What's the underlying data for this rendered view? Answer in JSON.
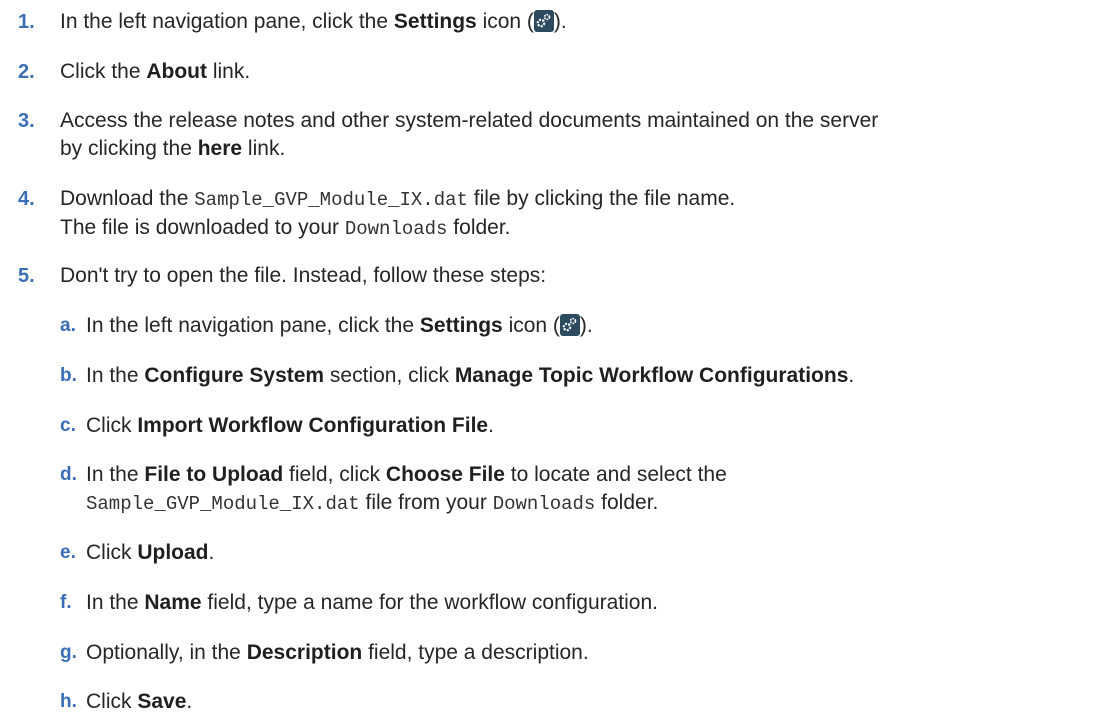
{
  "steps": [
    {
      "num": "1.",
      "parts": [
        {
          "t": "In the left navigation pane, click the "
        },
        {
          "b": "Settings"
        },
        {
          "t": " icon ("
        },
        {
          "icon": "settings-icon"
        },
        {
          "t": ")."
        }
      ]
    },
    {
      "num": "2.",
      "parts": [
        {
          "t": "Click the "
        },
        {
          "b": "About"
        },
        {
          "t": " link."
        }
      ]
    },
    {
      "num": "3.",
      "lines": [
        [
          {
            "t": "Access the release notes and other system-related documents maintained on the server"
          }
        ],
        [
          {
            "t": "by clicking the "
          },
          {
            "b": "here"
          },
          {
            "t": " link."
          }
        ]
      ]
    },
    {
      "num": "4.",
      "lines": [
        [
          {
            "t": "Download the "
          },
          {
            "m": "Sample_GVP_Module_IX.dat"
          },
          {
            "t": " file by clicking the file name."
          }
        ],
        [
          {
            "t": "The file is downloaded to your "
          },
          {
            "m": "Downloads"
          },
          {
            "t": " folder."
          }
        ]
      ]
    },
    {
      "num": "5.",
      "parts": [
        {
          "t": "Don't try to open the file. Instead, follow these steps:"
        }
      ]
    }
  ],
  "substeps": [
    {
      "num": "a.",
      "parts": [
        {
          "t": "In the left navigation pane, click the "
        },
        {
          "b": "Settings"
        },
        {
          "t": " icon ("
        },
        {
          "icon": "settings-icon"
        },
        {
          "t": ")."
        }
      ]
    },
    {
      "num": "b.",
      "parts": [
        {
          "t": "In the "
        },
        {
          "b": "Configure System"
        },
        {
          "t": " section, click "
        },
        {
          "b": "Manage Topic Workflow Configurations"
        },
        {
          "t": "."
        }
      ]
    },
    {
      "num": "c.",
      "parts": [
        {
          "t": "Click "
        },
        {
          "b": "Import Workflow Configuration File"
        },
        {
          "t": "."
        }
      ]
    },
    {
      "num": "d.",
      "lines": [
        [
          {
            "t": "In the "
          },
          {
            "b": "File to Upload"
          },
          {
            "t": " field, click "
          },
          {
            "b": "Choose File"
          },
          {
            "t": " to locate and select the"
          }
        ],
        [
          {
            "m": "Sample_GVP_Module_IX.dat"
          },
          {
            "t": " file from your "
          },
          {
            "m": "Downloads"
          },
          {
            "t": " folder."
          }
        ]
      ]
    },
    {
      "num": "e.",
      "parts": [
        {
          "t": "Click "
        },
        {
          "b": "Upload"
        },
        {
          "t": "."
        }
      ]
    },
    {
      "num": "f.",
      "parts": [
        {
          "t": "In the "
        },
        {
          "b": "Name"
        },
        {
          "t": " field, type a name for the workflow configuration."
        }
      ]
    },
    {
      "num": "g.",
      "parts": [
        {
          "t": "Optionally, in the "
        },
        {
          "b": "Description"
        },
        {
          "t": " field, type a description."
        }
      ]
    },
    {
      "num": "h.",
      "parts": [
        {
          "t": "Click "
        },
        {
          "b": "Save"
        },
        {
          "t": "."
        }
      ]
    }
  ]
}
